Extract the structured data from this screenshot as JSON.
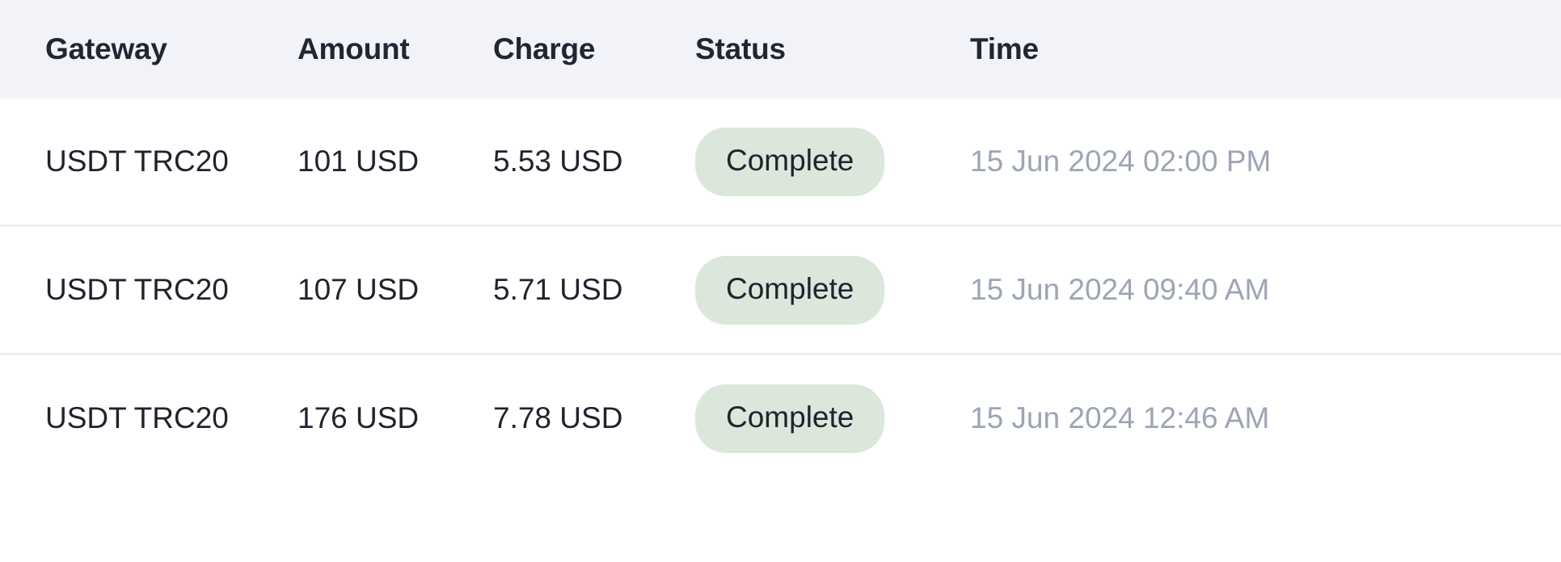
{
  "table": {
    "columns": [
      {
        "key": "gateway",
        "label": "Gateway"
      },
      {
        "key": "amount",
        "label": "Amount"
      },
      {
        "key": "charge",
        "label": "Charge"
      },
      {
        "key": "status",
        "label": "Status"
      },
      {
        "key": "time",
        "label": "Time"
      }
    ],
    "rows": [
      {
        "gateway": "USDT TRC20",
        "amount": "101 USD",
        "charge": "5.53 USD",
        "status": "Complete",
        "time": "15 Jun 2024 02:00 PM"
      },
      {
        "gateway": "USDT TRC20",
        "amount": "107 USD",
        "charge": "5.71 USD",
        "status": "Complete",
        "time": "15 Jun 2024 09:40 AM"
      },
      {
        "gateway": "USDT TRC20",
        "amount": "176 USD",
        "charge": "7.78 USD",
        "status": "Complete",
        "time": "15 Jun 2024 12:46 AM"
      }
    ]
  },
  "colors": {
    "header_background": "#f2f3f9",
    "header_text": "#222533",
    "row_background": "#ffffff",
    "row_text": "#1f232e",
    "row_divider": "#eceef2",
    "status_complete_background": "#dbe7db",
    "status_complete_text": "#1f232e",
    "time_text": "#9ca5b4"
  }
}
